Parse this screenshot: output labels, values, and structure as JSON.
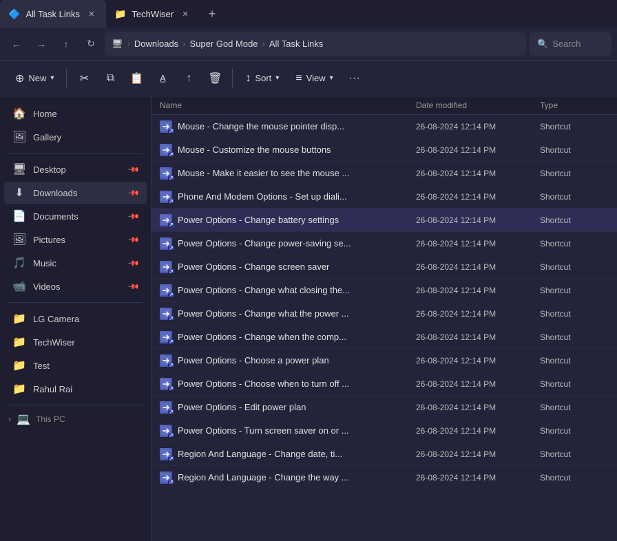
{
  "titleBar": {
    "tabs": [
      {
        "id": "tab1",
        "label": "All Task Links",
        "active": true,
        "icon": "🔷"
      },
      {
        "id": "tab2",
        "label": "TechWiser",
        "active": false,
        "icon": "📁"
      }
    ],
    "addTabLabel": "+"
  },
  "addressBar": {
    "backLabel": "←",
    "forwardLabel": "→",
    "upLabel": "↑",
    "refreshLabel": "↻",
    "computerIcon": "🖥",
    "breadcrumbs": [
      "Downloads",
      "Super God Mode",
      "All Task Links"
    ],
    "searchPlaceholder": "Search"
  },
  "toolbar": {
    "newLabel": "New",
    "newIcon": "⊕",
    "cutIcon": "✂",
    "copyIcon": "⧉",
    "pasteIcon": "📋",
    "renameIcon": "A",
    "shareIcon": "↑",
    "deleteIcon": "🗑",
    "sortLabel": "Sort",
    "sortIcon": "↕",
    "viewLabel": "View",
    "viewIcon": "≡",
    "moreIcon": "···"
  },
  "sidebar": {
    "items": [
      {
        "id": "home",
        "label": "Home",
        "icon": "🏠",
        "pinned": false
      },
      {
        "id": "gallery",
        "label": "Gallery",
        "icon": "🖼",
        "pinned": false
      }
    ],
    "pinnedItems": [
      {
        "id": "desktop",
        "label": "Desktop",
        "icon": "🖥",
        "pinned": true
      },
      {
        "id": "downloads",
        "label": "Downloads",
        "icon": "⬇",
        "pinned": true,
        "active": true
      },
      {
        "id": "documents",
        "label": "Documents",
        "icon": "📄",
        "pinned": true
      },
      {
        "id": "pictures",
        "label": "Pictures",
        "icon": "🖼",
        "pinned": true
      },
      {
        "id": "music",
        "label": "Music",
        "icon": "🎵",
        "pinned": true
      },
      {
        "id": "videos",
        "label": "Videos",
        "icon": "📹",
        "pinned": true
      }
    ],
    "folderItems": [
      {
        "id": "lgcamera",
        "label": "LG Camera",
        "icon": "📁"
      },
      {
        "id": "techwiser",
        "label": "TechWiser",
        "icon": "📁"
      },
      {
        "id": "test",
        "label": "Test",
        "icon": "📁"
      },
      {
        "id": "rahulrai",
        "label": "Rahul Rai",
        "icon": "📁"
      }
    ],
    "thisPC": {
      "label": "This PC",
      "icon": "💻"
    }
  },
  "fileList": {
    "columns": {
      "name": "Name",
      "dateModified": "Date modified",
      "type": "Type"
    },
    "files": [
      {
        "name": "Mouse - Change the mouse pointer disp...",
        "date": "26-08-2024 12:14 PM",
        "type": "Shortcut",
        "selected": false
      },
      {
        "name": "Mouse - Customize the mouse buttons",
        "date": "26-08-2024 12:14 PM",
        "type": "Shortcut",
        "selected": false
      },
      {
        "name": "Mouse - Make it easier to see the mouse ...",
        "date": "26-08-2024 12:14 PM",
        "type": "Shortcut",
        "selected": false
      },
      {
        "name": "Phone And Modem Options - Set up diali...",
        "date": "26-08-2024 12:14 PM",
        "type": "Shortcut",
        "selected": false
      },
      {
        "name": "Power Options - Change battery settings",
        "date": "26-08-2024 12:14 PM",
        "type": "Shortcut",
        "selected": true
      },
      {
        "name": "Power Options - Change power-saving se...",
        "date": "26-08-2024 12:14 PM",
        "type": "Shortcut",
        "selected": false
      },
      {
        "name": "Power Options - Change screen saver",
        "date": "26-08-2024 12:14 PM",
        "type": "Shortcut",
        "selected": false
      },
      {
        "name": "Power Options - Change what closing the...",
        "date": "26-08-2024 12:14 PM",
        "type": "Shortcut",
        "selected": false
      },
      {
        "name": "Power Options - Change what the power ...",
        "date": "26-08-2024 12:14 PM",
        "type": "Shortcut",
        "selected": false
      },
      {
        "name": "Power Options - Change when the comp...",
        "date": "26-08-2024 12:14 PM",
        "type": "Shortcut",
        "selected": false
      },
      {
        "name": "Power Options - Choose a power plan",
        "date": "26-08-2024 12:14 PM",
        "type": "Shortcut",
        "selected": false
      },
      {
        "name": "Power Options - Choose when to turn off ...",
        "date": "26-08-2024 12:14 PM",
        "type": "Shortcut",
        "selected": false
      },
      {
        "name": "Power Options - Edit power plan",
        "date": "26-08-2024 12:14 PM",
        "type": "Shortcut",
        "selected": false
      },
      {
        "name": "Power Options - Turn screen saver on or ...",
        "date": "26-08-2024 12:14 PM",
        "type": "Shortcut",
        "selected": false
      },
      {
        "name": "Region And Language - Change date, ti...",
        "date": "26-08-2024 12:14 PM",
        "type": "Shortcut",
        "selected": false
      },
      {
        "name": "Region And Language - Change the way ...",
        "date": "26-08-2024 12:14 PM",
        "type": "Shortcut",
        "selected": false
      }
    ]
  },
  "colors": {
    "bg": "#1a1a2e",
    "sidebar": "#1e1e30",
    "toolbar": "#23233a",
    "selected": "#2d2d55",
    "accent": "#5c6bc0"
  }
}
